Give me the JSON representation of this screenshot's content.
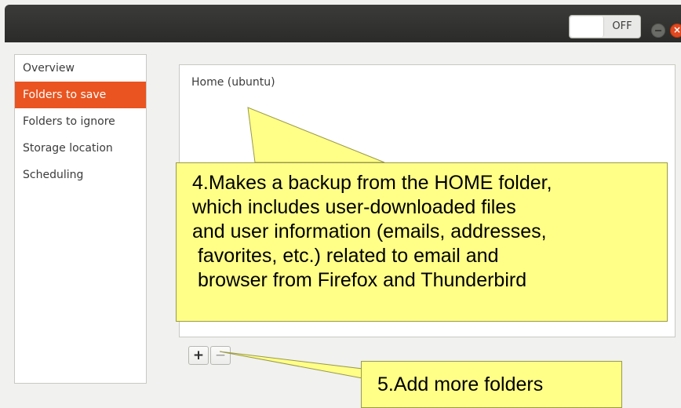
{
  "titlebar": {
    "toggle_label": "OFF",
    "close_glyph": "×"
  },
  "sidebar": {
    "items": [
      {
        "label": "Overview"
      },
      {
        "label": "Folders to save"
      },
      {
        "label": "Folders to ignore"
      },
      {
        "label": "Storage location"
      },
      {
        "label": "Scheduling"
      }
    ]
  },
  "folders": {
    "items": [
      {
        "label": "Home (ubuntu)"
      }
    ]
  },
  "toolbar": {
    "add_label": "+",
    "remove_label": "−"
  },
  "callouts": {
    "home_note": "4.Makes a backup from the HOME folder,\nwhich includes user-downloaded files\nand user information (emails, addresses,\n favorites, etc.) related to email and\n browser from Firefox and Thunderbird",
    "add_note": "5.Add more folders"
  },
  "colors": {
    "accent": "#e95420",
    "callout": "#ffff88"
  },
  "icons": {
    "minimize": "minimize-icon",
    "close": "close-icon"
  }
}
